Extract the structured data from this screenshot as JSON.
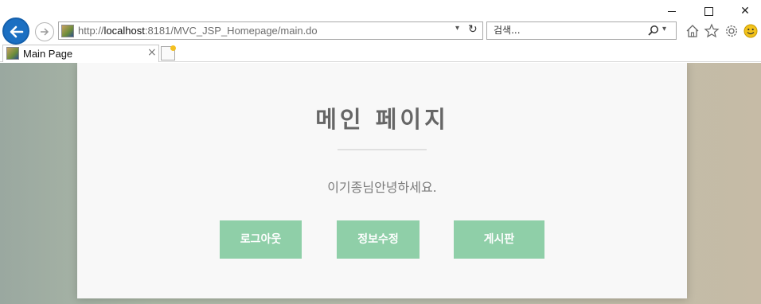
{
  "browser": {
    "address_url_prefix": "http://",
    "address_url_host": "localhost",
    "address_url_rest": ":8181/MVC_JSP_Homepage/main.do",
    "search_placeholder": "검색...",
    "tab_title": "Main Page"
  },
  "page": {
    "heading": "메인 페이지",
    "greeting": "이기종님안녕하세요.",
    "buttons": {
      "logout": "로그아웃",
      "edit_info": "정보수정",
      "board": "게시판"
    }
  },
  "colors": {
    "button_bg": "#8fcfa8",
    "back_button": "#1b6fc2"
  }
}
